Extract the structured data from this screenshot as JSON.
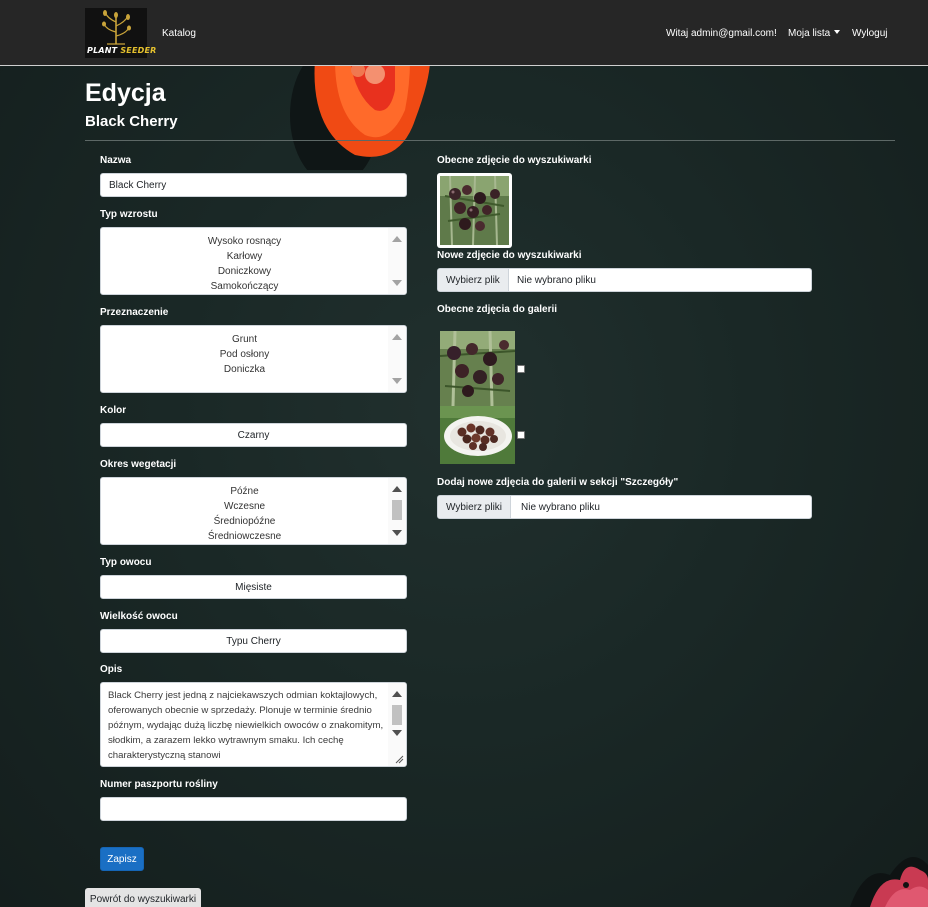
{
  "navbar": {
    "logo_word1": "PLANT",
    "logo_word2": "SEEDER",
    "catalog": "Katalog",
    "greeting": "Witaj admin@gmail.com!",
    "my_list": "Moja lista",
    "logout": "Wyloguj"
  },
  "header": {
    "title": "Edycja",
    "subtitle": "Black Cherry"
  },
  "form": {
    "name": {
      "label": "Nazwa",
      "value": "Black Cherry"
    },
    "growth_type": {
      "label": "Typ wzrostu",
      "options": [
        "Wysoko rosnący",
        "Karłowy",
        "Doniczkowy",
        "Samokończący"
      ]
    },
    "purpose": {
      "label": "Przeznaczenie",
      "options": [
        "Grunt",
        "Pod osłony",
        "Doniczka"
      ]
    },
    "color": {
      "label": "Kolor",
      "value": "Czarny"
    },
    "vegetation": {
      "label": "Okres wegetacji",
      "options": [
        "Późne",
        "Wczesne",
        "Średniopóźne",
        "Średniowczesne"
      ]
    },
    "fruit_type": {
      "label": "Typ owocu",
      "value": "Mięsiste"
    },
    "fruit_size": {
      "label": "Wielkość owocu",
      "value": "Typu Cherry"
    },
    "description": {
      "label": "Opis",
      "value": "Black Cherry jest jedną z najciekawszych odmian koktajlowych, oferowanych obecnie w sprzedaży. Plonuje w terminie średnio późnym, wydając dużą liczbę niewielkich owoców o znakomitym, słodkim, a zarazem lekko wytrawnym smaku. Ich cechę charakterystyczną stanowi"
    },
    "passport": {
      "label": "Numer paszportu rośliny",
      "value": ""
    },
    "save": "Zapisz",
    "back": "Powrót do wyszukiwarki"
  },
  "images": {
    "current_search_label": "Obecne zdjęcie do wyszukiwarki",
    "new_search_label": "Nowe zdjęcie do wyszukiwarki",
    "new_search_button": "Wybierz plik",
    "new_search_status": "Nie wybrano pliku",
    "gallery_label": "Obecne zdjęcia do galerii",
    "add_gallery_label": "Dodaj nowe zdjęcia do galerii w sekcji \"Szczegóły\"",
    "add_gallery_button": "Wybierz pliki",
    "add_gallery_status": "Nie wybrano pliku",
    "gallery_checked": [
      false,
      false
    ]
  },
  "colors": {
    "background": "#1a2826",
    "navbar": "#262626",
    "primary_button": "#1a6fc4"
  }
}
